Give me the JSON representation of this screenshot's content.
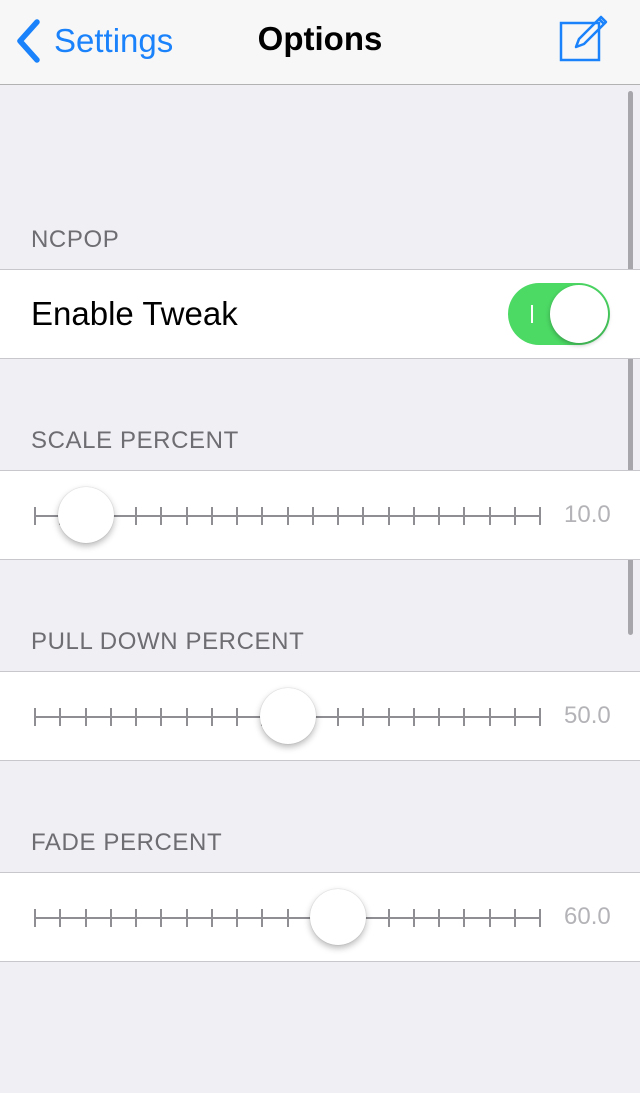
{
  "nav": {
    "back_label": "Settings",
    "title": "Options",
    "back_icon": "chevron-left-icon",
    "action_icon": "compose-icon"
  },
  "sections": {
    "ncpop": {
      "header": "NCPOP",
      "toggle_label": "Enable Tweak",
      "toggle_on": true,
      "toggle_mark": "I"
    },
    "scale": {
      "header": "SCALE PERCENT",
      "value": 10.0,
      "value_text": "10.0"
    },
    "pulldown": {
      "header": "PULL DOWN PERCENT",
      "value": 50.0,
      "value_text": "50.0"
    },
    "fade": {
      "header": "FADE PERCENT",
      "value": 60.0,
      "value_text": "60.0"
    }
  },
  "slider": {
    "min": 0,
    "max": 100,
    "ticks": 21
  },
  "colors": {
    "accent": "#1a82fb",
    "toggle_on": "#4cd964",
    "background": "#efeff4"
  }
}
